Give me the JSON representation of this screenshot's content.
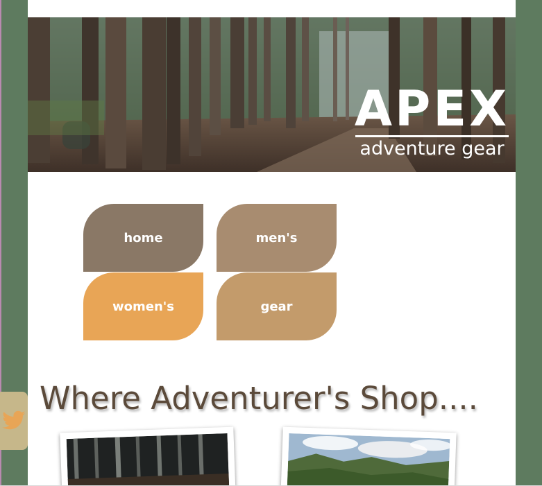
{
  "logo": {
    "title": "APEX",
    "subtitle": "adventure gear"
  },
  "nav": [
    {
      "label": "home"
    },
    {
      "label": "men's"
    },
    {
      "label": "women's"
    },
    {
      "label": "gear"
    }
  ],
  "headline": "Where Adventurer's Shop....",
  "social": {
    "icon": "twitter-icon"
  },
  "colors": {
    "background": "#5e7b5f",
    "nav_home": "#8a7866",
    "nav_mens": "#a88c70",
    "nav_womens": "#e8a556",
    "nav_gear": "#c39b6b",
    "headline": "#5b4a3a"
  }
}
